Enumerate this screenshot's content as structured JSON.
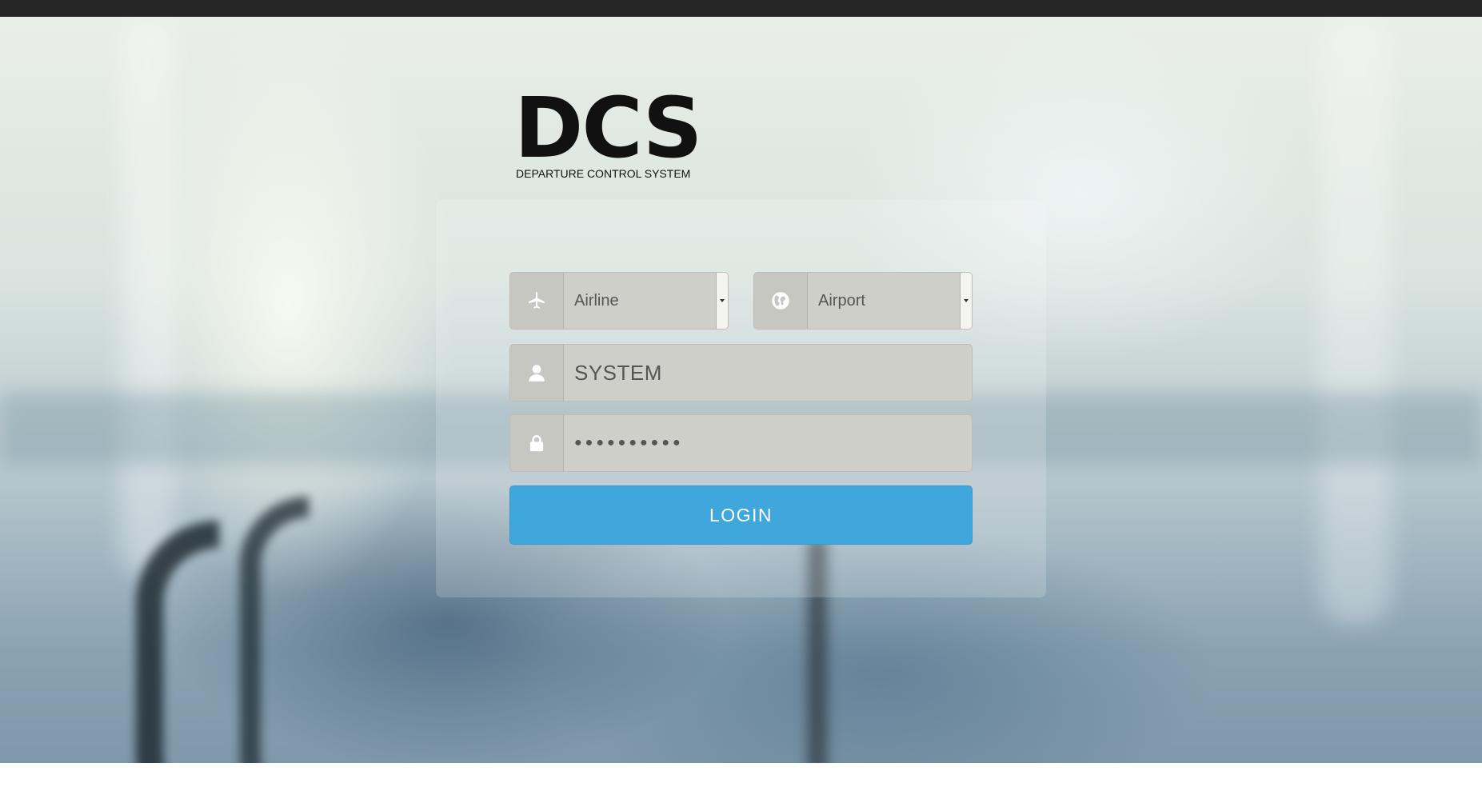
{
  "app": {
    "logo_text": "DCS",
    "logo_subtitle": "DEPARTURE CONTROL SYSTEM"
  },
  "form": {
    "airline": {
      "value": "Airline",
      "icon": "airplane-icon"
    },
    "airport": {
      "value": "Airport",
      "icon": "globe-icon"
    },
    "username": {
      "value": "SYSTEM",
      "icon": "user-icon"
    },
    "password": {
      "value": "●●●●●●●●●●",
      "icon": "lock-icon"
    },
    "login_label": "LOGIN"
  },
  "colors": {
    "accent": "#3fa7dc",
    "topbar": "#262626",
    "field_bg": "#cfcfca"
  }
}
